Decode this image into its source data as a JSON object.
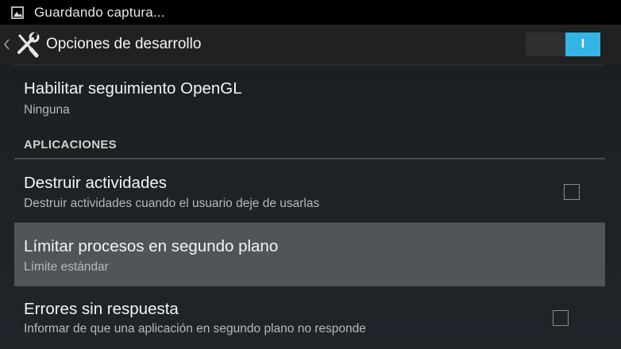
{
  "status_bar": {
    "icon": "image-icon",
    "text": "Guardando captura..."
  },
  "action_bar": {
    "up_icon": "chevron-left-icon",
    "app_icon": "tools-icon",
    "title": "Opciones de desarrollo",
    "switch_state": "on",
    "switch_label": "I",
    "accent_color": "#33b5e5"
  },
  "prefs": {
    "opengl": {
      "title": "Habilitar seguimiento OpenGL",
      "summary": "Ninguna"
    },
    "section_header": "APLICACIONES",
    "destroy": {
      "title": "Destruir actividades",
      "summary": "Destruir actividades cuando el usuario deje de usarlas",
      "checked": false
    },
    "limit": {
      "title": "Límitar procesos en segundo plano",
      "summary": "Límite estándar",
      "pressed": true
    },
    "anr": {
      "title": "Errores sin respuesta",
      "summary": "Informar de que una aplicación en segundo plano no responde",
      "checked": false
    }
  }
}
